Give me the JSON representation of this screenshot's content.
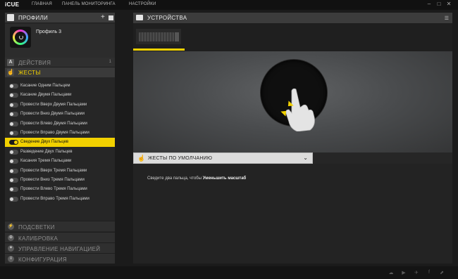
{
  "app": {
    "logo": "iCUE",
    "menu": [
      "ГЛАВНАЯ",
      "ПАНЕЛЬ МОНИТОРИНГА",
      "НАСТРОЙКИ"
    ],
    "window_controls": [
      "–",
      "□",
      "✕"
    ]
  },
  "left": {
    "profiles_title": "ПРОФИЛИ",
    "profile_name": "Профиль 3",
    "actions_title": "ДЕЙСТВИЯ",
    "actions_count": "1",
    "actions_icon": "A",
    "gestures_title": "ЖЕСТЫ",
    "gestures": [
      {
        "label": "Касание Одним Пальцем",
        "on": false
      },
      {
        "label": "Касание Двумя Пальцами",
        "on": false
      },
      {
        "label": "Провести Вверх Двумя Пальцами",
        "on": false
      },
      {
        "label": "Провести Вниз Двумя Пальцами",
        "on": false
      },
      {
        "label": "Провести Влево Двумя Пальцами",
        "on": false
      },
      {
        "label": "Провести Вправо Двумя Пальцами",
        "on": false
      },
      {
        "label": "Сведение Двух Пальцев",
        "on": true
      },
      {
        "label": "Разведение Двух Пальцев",
        "on": false
      },
      {
        "label": "Касания Тремя Пальцами",
        "on": false
      },
      {
        "label": "Провести Вверх Тремя Пальцами",
        "on": false
      },
      {
        "label": "Провести Вниз Тремя Пальцами",
        "on": false
      },
      {
        "label": "Провести Влево Тремя Пальцами",
        "on": false
      },
      {
        "label": "Провести Вправо Тремя Пальцами",
        "on": false
      }
    ],
    "bottom_sections": [
      "ПОДСВЕТКИ",
      "КАЛИБРОВКА",
      "УПРАВЛЕНИЕ НАВИГАЦИЕЙ",
      "КОНФИГУРАЦИЯ"
    ]
  },
  "right": {
    "devices_title": "УСТРОЙСТВА",
    "default_gestures_title": "ЖЕСТЫ ПО УМОЛЧАНИЮ",
    "description_prefix": "Сведите два пальца, чтобы",
    "description_action": "Уменьшить масштаб"
  },
  "colors": {
    "accent": "#f2d100",
    "background": "#1b1b1b",
    "panel": "#262626"
  }
}
